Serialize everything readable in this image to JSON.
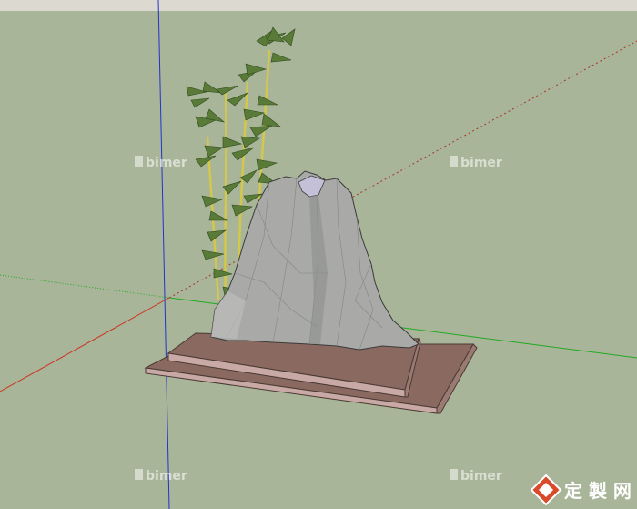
{
  "viewport": {
    "sky_color": "#dcdad0",
    "ground_color": "#a8b599",
    "axis_colors": {
      "red": "#cc3322",
      "green": "#22aa22",
      "blue": "#2233cc"
    }
  },
  "model": {
    "rock_color": "#a9aaa8",
    "rock_top_color": "#c4c0d8",
    "plinth_top_color": "#8a6a60",
    "plinth_side_color": "#c9a9a5",
    "bamboo_leaf_color": "#5a7a38",
    "bamboo_stem_color": "#d4c84a"
  },
  "watermarks": [
    {
      "text": "bimer",
      "icon": "bimer-logo-icon"
    },
    {
      "text": "bimer",
      "icon": "bimer-logo-icon"
    },
    {
      "text": "bimer",
      "icon": "bimer-logo-icon"
    },
    {
      "text": "bimer",
      "icon": "bimer-logo-icon"
    }
  ],
  "logo": {
    "text": "定 製 网",
    "icon": "zhulong-diamond-icon"
  }
}
